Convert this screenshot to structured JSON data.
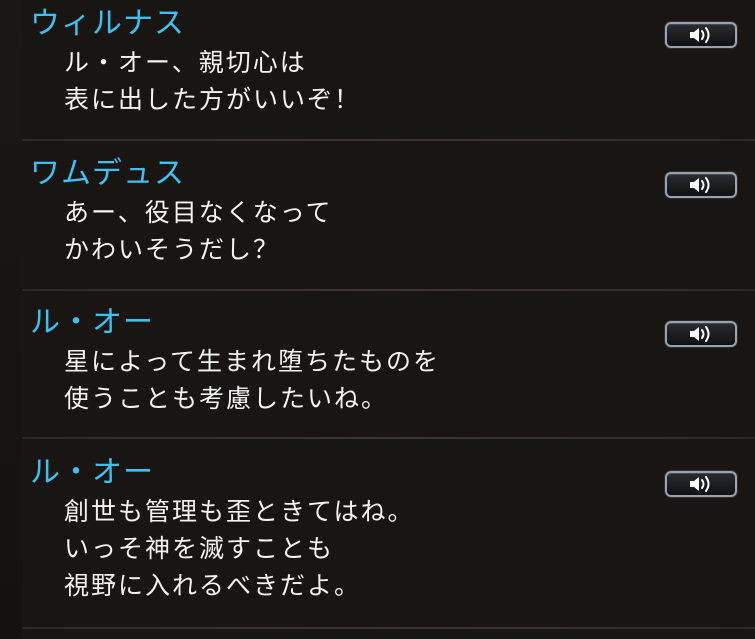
{
  "entries": [
    {
      "speaker": "ウィルナス",
      "lines": [
        "ル・オー、親切心は",
        "表に出した方がいいぞ！"
      ]
    },
    {
      "speaker": "ワムデュス",
      "lines": [
        "あー、役目なくなって",
        "かわいそうだし？"
      ]
    },
    {
      "speaker": "ル・オー",
      "lines": [
        "星によって生まれ堕ちたものを",
        "使うことも考慮したいね。"
      ]
    },
    {
      "speaker": "ル・オー",
      "lines": [
        "創世も管理も歪ときてはね。",
        "いっそ神を滅すことも",
        "視野に入れるべきだよ。"
      ]
    }
  ],
  "icons": {
    "voice": "speaker-volume-icon"
  },
  "colors": {
    "speaker_name": "#3ec0f0",
    "dialogue_text": "#f2f2f2",
    "background": "#181513"
  }
}
